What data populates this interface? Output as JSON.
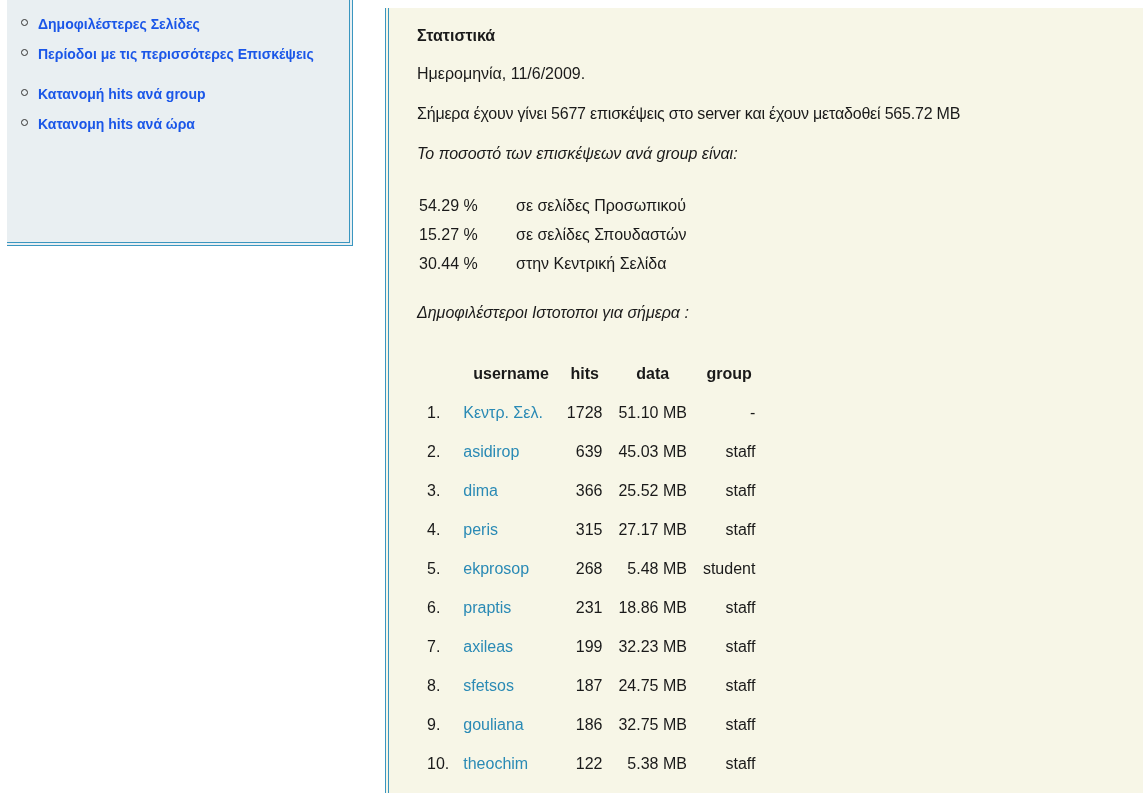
{
  "sidebar": {
    "items": [
      {
        "label": "Δημοφιλέστερες Σελίδες"
      },
      {
        "label": "Περίοδοι με τις περισσότερες Επισκέψεις"
      },
      {
        "label": "Κατανομή hits ανά group"
      },
      {
        "label": "Κατανομη hits ανά ώρα"
      }
    ]
  },
  "main": {
    "title": "Στατιστικά",
    "date_line": "Ημερομηνία, 11/6/2009.",
    "summary": "Σήμερα έχουν γίνει 5677 επισκέψεις στο server και έχουν μεταδοθεί 565.72 MB",
    "percent_intro": "Το ποσοστό των επισκέψεων ανά group είναι:",
    "percentages": [
      {
        "percent": "54.29 %",
        "label": "σε σελίδες Προσωπικού"
      },
      {
        "percent": "15.27 %",
        "label": "σε σελίδες Σπουδαστών"
      },
      {
        "percent": "30.44 %",
        "label": "στην Κεντρική Σελίδα"
      }
    ],
    "popular_intro": "Δημοφιλέστεροι Ιστοτοποι για σήμερα :",
    "table": {
      "columns": [
        "username",
        "hits",
        "data",
        "group"
      ],
      "rows": [
        {
          "rank": "1.",
          "username": "Κεντρ. Σελ.",
          "hits": "1728",
          "data": "51.10 MB",
          "group": "-"
        },
        {
          "rank": "2.",
          "username": "asidirop",
          "hits": "639",
          "data": "45.03 MB",
          "group": "staff"
        },
        {
          "rank": "3.",
          "username": "dima",
          "hits": "366",
          "data": "25.52 MB",
          "group": "staff"
        },
        {
          "rank": "4.",
          "username": "peris",
          "hits": "315",
          "data": "27.17 MB",
          "group": "staff"
        },
        {
          "rank": "5.",
          "username": "ekprosop",
          "hits": "268",
          "data": "5.48 MB",
          "group": "student"
        },
        {
          "rank": "6.",
          "username": "praptis",
          "hits": "231",
          "data": "18.86 MB",
          "group": "staff"
        },
        {
          "rank": "7.",
          "username": "axileas",
          "hits": "199",
          "data": "32.23 MB",
          "group": "staff"
        },
        {
          "rank": "8.",
          "username": "sfetsos",
          "hits": "187",
          "data": "24.75 MB",
          "group": "staff"
        },
        {
          "rank": "9.",
          "username": "gouliana",
          "hits": "186",
          "data": "32.75 MB",
          "group": "staff"
        },
        {
          "rank": "10.",
          "username": "theochim",
          "hits": "122",
          "data": "5.38 MB",
          "group": "staff"
        }
      ]
    }
  }
}
